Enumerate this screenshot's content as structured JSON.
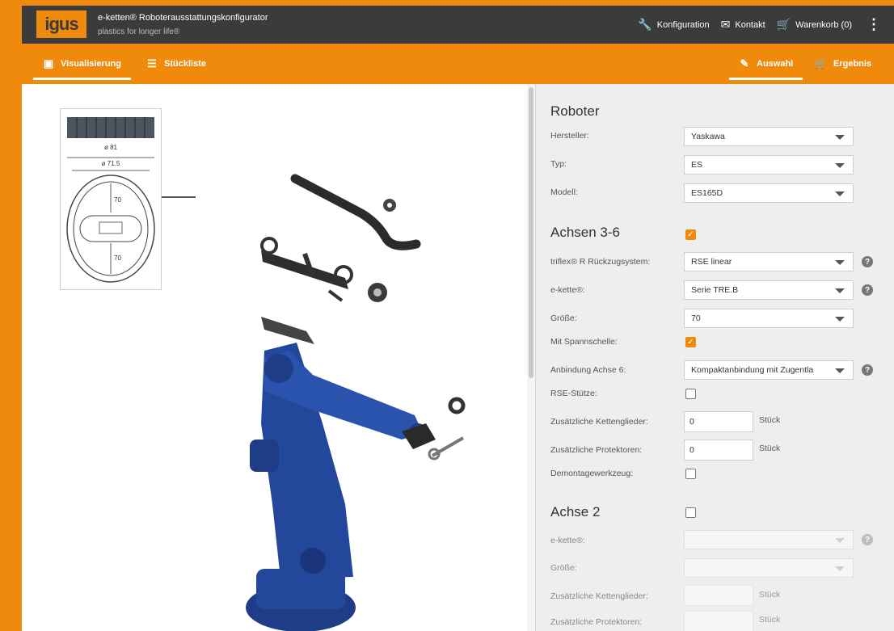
{
  "header": {
    "logo": "igus",
    "title": "e-ketten® Roboterausstattungskonfigurator",
    "subtitle": "plastics for longer life®",
    "nav": {
      "konfiguration": "Konfiguration",
      "kontakt": "Kontakt",
      "warenkorb": "Warenkorb (0)"
    }
  },
  "tabs": {
    "visualisierung": "Visualisierung",
    "stueckliste": "Stückliste",
    "auswahl": "Auswahl",
    "ergebnis": "Ergebnis"
  },
  "drawing": {
    "d_outer": "ø 81",
    "d_inner": "ø 71.5",
    "r_top": "70",
    "r_bottom": "70"
  },
  "roboter": {
    "heading": "Roboter",
    "hersteller_label": "Hersteller:",
    "hersteller_value": "Yaskawa",
    "typ_label": "Typ:",
    "typ_value": "ES",
    "modell_label": "Modell:",
    "modell_value": "ES165D"
  },
  "achsen36": {
    "heading": "Achsen 3-6",
    "checked": true,
    "triflex_label": "triflex® R Rückzugsystem:",
    "triflex_value": "RSE linear",
    "ekette_label": "e-kette®:",
    "ekette_value": "Serie TRE.B",
    "groesse_label": "Größe:",
    "groesse_value": "70",
    "spannschelle_label": "Mit Spannschelle:",
    "spannschelle_checked": true,
    "anbindung_label": "Anbindung Achse 6:",
    "anbindung_value": "Kompaktanbindung mit Zugentla",
    "rse_label": "RSE-Stütze:",
    "rse_checked": false,
    "kettenglieder_label": "Zusätzliche Kettenglieder:",
    "kettenglieder_value": "0",
    "protektoren_label": "Zusätzliche Protektoren:",
    "protektoren_value": "0",
    "unit": "Stück",
    "demontage_label": "Demontagewerkzeug:",
    "demontage_checked": false
  },
  "achse2": {
    "heading": "Achse 2",
    "checked": false,
    "ekette_label": "e-kette®:",
    "groesse_label": "Größe:",
    "kettenglieder_label": "Zusätzliche Kettenglieder:",
    "protektoren_label": "Zusätzliche Protektoren:",
    "unit": "Stück"
  },
  "colors": {
    "brand_orange": "#f08a0c",
    "header_dark": "#3b3b3b",
    "robot_blue": "#23479a"
  }
}
